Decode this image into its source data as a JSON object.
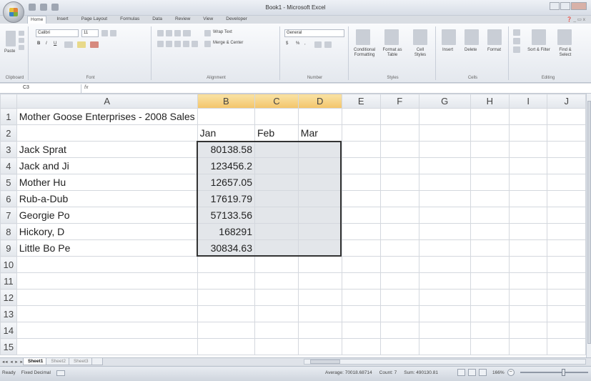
{
  "window": {
    "title": "Book1 - Microsoft Excel"
  },
  "ribbon": {
    "tabs": [
      "Home",
      "Insert",
      "Page Layout",
      "Formulas",
      "Data",
      "Review",
      "View",
      "Developer"
    ],
    "help_icons": "❓ _ ▭ x",
    "clipboard": {
      "label": "Clipboard",
      "paste": "Paste"
    },
    "font": {
      "label": "Font",
      "name": "Calibri",
      "size": "11",
      "bold": "B",
      "italic": "I",
      "underline": "U"
    },
    "alignment": {
      "label": "Alignment",
      "wrap": "Wrap Text",
      "merge": "Merge & Center"
    },
    "number": {
      "label": "Number",
      "format": "General",
      "dollar": "$",
      "percent": "%",
      "comma": ","
    },
    "styles": {
      "label": "Styles",
      "conditional": "Conditional Formatting",
      "format_table": "Format as Table",
      "cell_styles": "Cell Styles"
    },
    "cells": {
      "label": "Cells",
      "insert": "Insert",
      "delete": "Delete",
      "format": "Format"
    },
    "editing": {
      "label": "Editing",
      "sort": "Sort & Filter",
      "find": "Find & Select"
    }
  },
  "formula_bar": {
    "name_box": "C3",
    "fx": "fx",
    "content": ""
  },
  "columns": [
    "A",
    "B",
    "C",
    "D",
    "E",
    "F",
    "G",
    "H",
    "I",
    "J"
  ],
  "rows": [
    {
      "num": "1",
      "cells": [
        "Mother Goose Enterprises - 2008 Sales",
        "",
        "",
        "",
        "",
        "",
        "",
        "",
        "",
        ""
      ]
    },
    {
      "num": "2",
      "cells": [
        "",
        "Jan",
        "Feb",
        "Mar",
        "",
        "",
        "",
        "",
        "",
        ""
      ]
    },
    {
      "num": "3",
      "cells": [
        "Jack Sprat",
        "80138.58",
        "",
        "",
        "",
        "",
        "",
        "",
        "",
        ""
      ]
    },
    {
      "num": "4",
      "cells": [
        "Jack and Ji",
        "123456.2",
        "",
        "",
        "",
        "",
        "",
        "",
        "",
        ""
      ]
    },
    {
      "num": "5",
      "cells": [
        "Mother Hu",
        "12657.05",
        "",
        "",
        "",
        "",
        "",
        "",
        "",
        ""
      ]
    },
    {
      "num": "6",
      "cells": [
        "Rub-a-Dub",
        "17619.79",
        "",
        "",
        "",
        "",
        "",
        "",
        "",
        ""
      ]
    },
    {
      "num": "7",
      "cells": [
        "Georgie Po",
        "57133.56",
        "",
        "",
        "",
        "",
        "",
        "",
        "",
        ""
      ]
    },
    {
      "num": "8",
      "cells": [
        "Hickory, D",
        "168291",
        "",
        "",
        "",
        "",
        "",
        "",
        "",
        ""
      ]
    },
    {
      "num": "9",
      "cells": [
        "Little Bo Pe",
        "30834.63",
        "",
        "",
        "",
        "",
        "",
        "",
        "",
        ""
      ]
    },
    {
      "num": "10",
      "cells": [
        "",
        "",
        "",
        "",
        "",
        "",
        "",
        "",
        "",
        ""
      ]
    },
    {
      "num": "11",
      "cells": [
        "",
        "",
        "",
        "",
        "",
        "",
        "",
        "",
        "",
        ""
      ]
    },
    {
      "num": "12",
      "cells": [
        "",
        "",
        "",
        "",
        "",
        "",
        "",
        "",
        "",
        ""
      ]
    },
    {
      "num": "13",
      "cells": [
        "",
        "",
        "",
        "",
        "",
        "",
        "",
        "",
        "",
        ""
      ]
    },
    {
      "num": "14",
      "cells": [
        "",
        "",
        "",
        "",
        "",
        "",
        "",
        "",
        "",
        ""
      ]
    },
    {
      "num": "15",
      "cells": [
        "",
        "",
        "",
        "",
        "",
        "",
        "",
        "",
        "",
        ""
      ]
    }
  ],
  "sheet_tabs": [
    "Sheet1",
    "Sheet2",
    "Sheet3"
  ],
  "sheet_nav": "◂◂ ◂ ▸ ▸▸",
  "status": {
    "mode": "Ready",
    "fixed_decimal": "Fixed Decimal",
    "average": "Average: 70018.68714",
    "count": "Count: 7",
    "sum": "Sum: 490130.81",
    "zoom": "166%",
    "zoom_minus": "−",
    "zoom_plus": "+"
  },
  "colors": {
    "selection_border": "#333333",
    "selection_fill": "#e3e6ea",
    "selected_header": "#f3c46a"
  }
}
